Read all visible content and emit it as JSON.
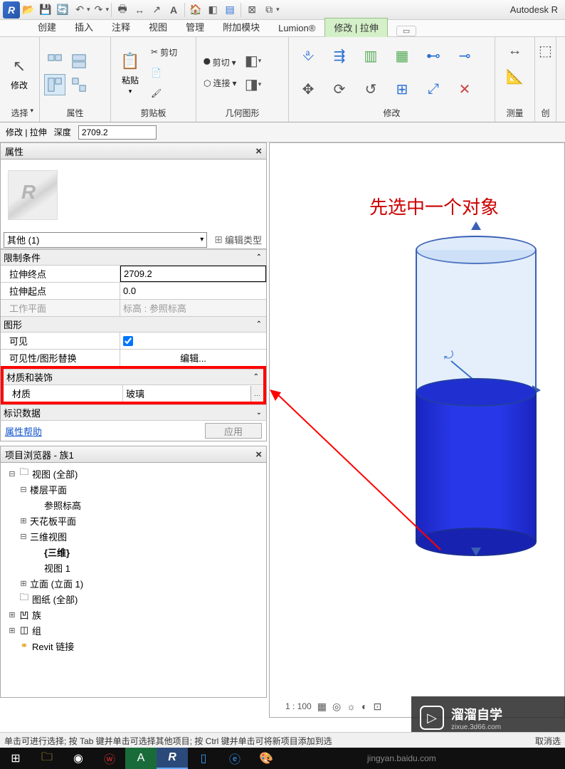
{
  "app": {
    "title": "Autodesk R"
  },
  "qat": {
    "icons": [
      "open",
      "save",
      "sync",
      "undo",
      "redo",
      "print",
      "dim",
      "angle",
      "text",
      "3d",
      "section",
      "thin",
      "sheet",
      "switch",
      "close"
    ]
  },
  "ribbon_tabs": {
    "items": [
      "创建",
      "插入",
      "注释",
      "视图",
      "管理",
      "附加模块",
      "Lumion®",
      "修改 | 拉伸"
    ],
    "active_index": 7,
    "expand": "▭"
  },
  "ribbon_panels": {
    "select": {
      "label": "选择",
      "btn": "修改"
    },
    "props": {
      "label": "属性"
    },
    "clipboard": {
      "label": "剪贴板",
      "paste": "粘贴",
      "cut": "剪切",
      "copy": "复制",
      "connect": "连接"
    },
    "geometry": {
      "label": "几何图形",
      "cut": "剪切",
      "connect": "连接"
    },
    "modify": {
      "label": "修改"
    },
    "measure": {
      "label": "测量"
    },
    "create": {
      "label": "创"
    }
  },
  "optbar": {
    "context": "修改 | 拉伸",
    "depth_lbl": "深度",
    "depth_val": "2709.2"
  },
  "properties": {
    "title": "属性",
    "type_selector": "其他 (1)",
    "edit_type": "编辑类型",
    "cat_constraints": "限制条件",
    "extrude_end_k": "拉伸终点",
    "extrude_end_v": "2709.2",
    "extrude_start_k": "拉伸起点",
    "extrude_start_v": "0.0",
    "workplane_k": "工作平面",
    "workplane_v": "标高 : 参照标高",
    "cat_graphics": "图形",
    "visible_k": "可见",
    "visoverride_k": "可见性/图形替换",
    "visoverride_v": "编辑...",
    "cat_material": "材质和装饰",
    "material_k": "材质",
    "material_v": "玻璃",
    "cat_identity": "标识数据",
    "help": "属性帮助",
    "apply": "应用"
  },
  "browser": {
    "title": "项目浏览器 - 族1",
    "views_all": "视图 (全部)",
    "floor_plans": "楼层平面",
    "ref_level": "参照标高",
    "ceiling_plans": "天花板平面",
    "three_d_views": "三维视图",
    "three_d": "{三维}",
    "view1": "视图 1",
    "elevations": "立面 (立面 1)",
    "sheets": "图纸 (全部)",
    "families": "族",
    "groups": "组",
    "revit_links": "Revit 链接"
  },
  "viewport": {
    "annotation": "先选中一个对象",
    "scale": "1 : 100"
  },
  "watermark": {
    "name": "溜溜自学",
    "url": "zixue.3d66.com"
  },
  "status": {
    "text": "单击可进行选择; 按 Tab 键并单击可选择其他项目; 按 Ctrl 键并单击可将新项目添加到选",
    "text2": "取消选"
  },
  "taskbar": {
    "url": "jingyan.baidu.com"
  }
}
